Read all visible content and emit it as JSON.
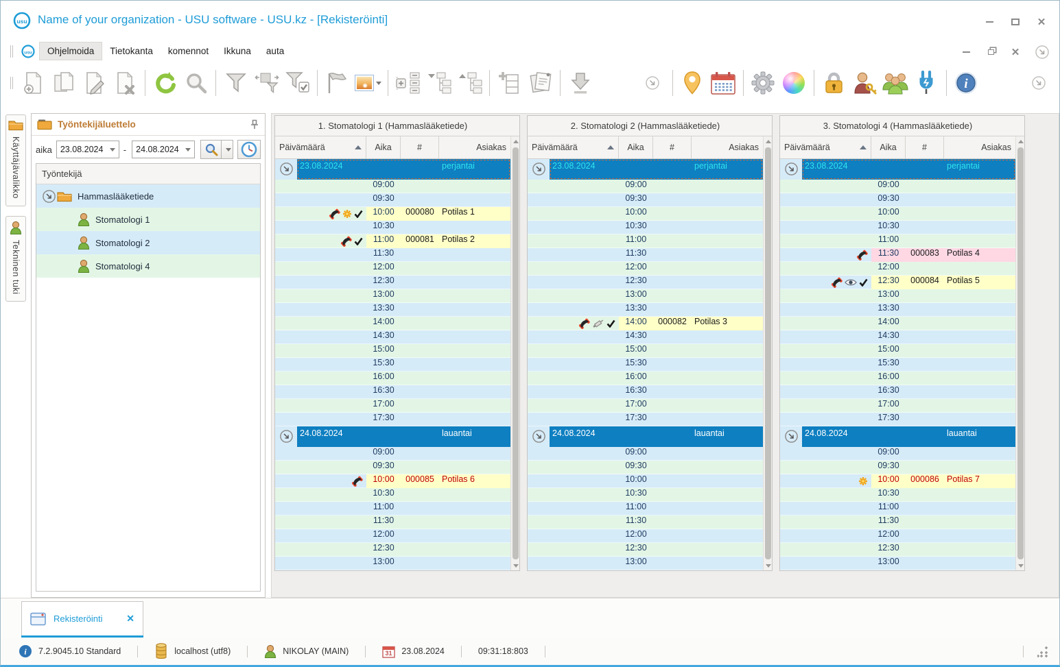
{
  "window": {
    "title": "Name of your organization - USU software - USU.kz - [Rekisteröinti]",
    "controls": [
      "minimize",
      "maximize",
      "close"
    ],
    "mdi_controls": [
      "minimize",
      "restore",
      "close",
      "chevron-circle"
    ]
  },
  "menu": {
    "items": [
      {
        "label": "Ohjelmoida",
        "highlighted": true
      },
      {
        "label": "Tietokanta",
        "highlighted": false
      },
      {
        "label": "komennot",
        "highlighted": false
      },
      {
        "label": "Ikkuna",
        "highlighted": false
      },
      {
        "label": "auta",
        "highlighted": false
      }
    ]
  },
  "toolbar": {
    "items": [
      {
        "type": "grip"
      },
      {
        "type": "icon",
        "name": "doc-new"
      },
      {
        "type": "icon",
        "name": "doc-copy"
      },
      {
        "type": "icon",
        "name": "doc-edit"
      },
      {
        "type": "icon",
        "name": "doc-delete"
      },
      {
        "type": "sep"
      },
      {
        "type": "icon",
        "name": "refresh"
      },
      {
        "type": "icon",
        "name": "search"
      },
      {
        "type": "sep"
      },
      {
        "type": "icon",
        "name": "filter"
      },
      {
        "type": "icon",
        "name": "filter-columns"
      },
      {
        "type": "icon",
        "name": "filter-check"
      },
      {
        "type": "sep"
      },
      {
        "type": "icon",
        "name": "flag"
      },
      {
        "type": "icon",
        "name": "image",
        "dropdown": true
      },
      {
        "type": "sep"
      },
      {
        "type": "icon",
        "name": "tree-toggle"
      },
      {
        "type": "icon",
        "name": "tree-down"
      },
      {
        "type": "icon",
        "name": "tree-up"
      },
      {
        "type": "sep"
      },
      {
        "type": "icon",
        "name": "add-row"
      },
      {
        "type": "icon",
        "name": "documents"
      },
      {
        "type": "sep"
      },
      {
        "type": "icon",
        "name": "download"
      },
      {
        "type": "spacer"
      },
      {
        "type": "icon",
        "name": "chevron-circle"
      },
      {
        "type": "sep"
      },
      {
        "type": "icon",
        "name": "map-pin"
      },
      {
        "type": "icon",
        "name": "calendar"
      },
      {
        "type": "sep"
      },
      {
        "type": "icon",
        "name": "gear"
      },
      {
        "type": "icon",
        "name": "color-wheel"
      },
      {
        "type": "sep"
      },
      {
        "type": "icon",
        "name": "lock"
      },
      {
        "type": "icon",
        "name": "user-key"
      },
      {
        "type": "icon",
        "name": "user-group"
      },
      {
        "type": "icon",
        "name": "plug"
      },
      {
        "type": "sep"
      },
      {
        "type": "icon",
        "name": "info"
      },
      {
        "type": "spacer"
      },
      {
        "type": "icon",
        "name": "chevron-circle"
      }
    ]
  },
  "sidebar": {
    "tabs": [
      {
        "label": "Käyttäjävalikko",
        "icon": "folder-open"
      },
      {
        "label": "Tekninen tuki",
        "icon": "person"
      }
    ]
  },
  "employee_panel": {
    "title": "Työntekijäluettelo",
    "pin_icon": "pushpin",
    "filter": {
      "label": "aika",
      "from_value": "23.08.2024",
      "separator": "-",
      "to_value": "24.08.2024",
      "buttons": [
        "search",
        "search-dropdown",
        "clock"
      ]
    },
    "tree_header": "Työntekijä",
    "tree": [
      {
        "label": "Hammaslääketiede",
        "icon": "folder-open",
        "level": 0,
        "row": "blue",
        "expander": true
      },
      {
        "label": "Stomatologi 1",
        "icon": "person",
        "level": 1,
        "row": "green",
        "expander": false
      },
      {
        "label": "Stomatologi 2",
        "icon": "person",
        "level": 1,
        "row": "blue",
        "expander": false
      },
      {
        "label": "Stomatologi 4",
        "icon": "person",
        "level": 1,
        "row": "green",
        "expander": false
      }
    ]
  },
  "schedules": [
    {
      "title": "1. Stomatologi 1 (Hammaslääketiede)",
      "columns": {
        "date": "Päivämäärä",
        "time": "Aika",
        "number": "#",
        "client": "Asiakas"
      },
      "days": [
        {
          "date": "23.08.2024",
          "weekday": "perjantai",
          "focused": true,
          "start": "green",
          "slots": [
            {
              "time": "09:00"
            },
            {
              "time": "09:30"
            },
            {
              "time": "10:00",
              "number": "000080",
              "client": "Potilas 1",
              "icons": [
                "phone",
                "spark",
                "check"
              ],
              "highlight": "yellow",
              "text": "black"
            },
            {
              "time": "10:30"
            },
            {
              "time": "11:00",
              "number": "000081",
              "client": "Potilas 2",
              "icons": [
                "phone",
                "check"
              ],
              "highlight": "yellow",
              "text": "black"
            },
            {
              "time": "11:30"
            },
            {
              "time": "12:00"
            },
            {
              "time": "12:30"
            },
            {
              "time": "13:00"
            },
            {
              "time": "13:30"
            },
            {
              "time": "14:00"
            },
            {
              "time": "14:30"
            },
            {
              "time": "15:00"
            },
            {
              "time": "15:30"
            },
            {
              "time": "16:00"
            },
            {
              "time": "16:30"
            },
            {
              "time": "17:00"
            },
            {
              "time": "17:30"
            }
          ]
        },
        {
          "date": "24.08.2024",
          "weekday": "lauantai",
          "focused": false,
          "start": "blue",
          "slots": [
            {
              "time": "09:00"
            },
            {
              "time": "09:30"
            },
            {
              "time": "10:00",
              "number": "000085",
              "client": "Potilas 6",
              "icons": [
                "phone"
              ],
              "highlight": "yellow",
              "text": "red"
            },
            {
              "time": "10:30"
            },
            {
              "time": "11:00"
            },
            {
              "time": "11:30"
            },
            {
              "time": "12:00"
            },
            {
              "time": "12:30"
            },
            {
              "time": "13:00"
            }
          ]
        }
      ]
    },
    {
      "title": "2. Stomatologi 2 (Hammaslääketiede)",
      "columns": {
        "date": "Päivämäärä",
        "time": "Aika",
        "number": "#",
        "client": "Asiakas"
      },
      "days": [
        {
          "date": "23.08.2024",
          "weekday": "perjantai",
          "focused": true,
          "start": "green",
          "slots": [
            {
              "time": "09:00"
            },
            {
              "time": "09:30"
            },
            {
              "time": "10:00"
            },
            {
              "time": "10:30"
            },
            {
              "time": "11:00"
            },
            {
              "time": "11:30"
            },
            {
              "time": "12:00"
            },
            {
              "time": "12:30"
            },
            {
              "time": "13:00"
            },
            {
              "time": "13:30"
            },
            {
              "time": "14:00",
              "number": "000082",
              "client": "Potilas 3",
              "icons": [
                "phone",
                "syringe",
                "check"
              ],
              "highlight": "yellow",
              "text": "black"
            },
            {
              "time": "14:30"
            },
            {
              "time": "15:00"
            },
            {
              "time": "15:30"
            },
            {
              "time": "16:00"
            },
            {
              "time": "16:30"
            },
            {
              "time": "17:00"
            },
            {
              "time": "17:30"
            }
          ]
        },
        {
          "date": "24.08.2024",
          "weekday": "lauantai",
          "focused": false,
          "start": "blue",
          "slots": [
            {
              "time": "09:00"
            },
            {
              "time": "09:30"
            },
            {
              "time": "10:00"
            },
            {
              "time": "10:30"
            },
            {
              "time": "11:00"
            },
            {
              "time": "11:30"
            },
            {
              "time": "12:00"
            },
            {
              "time": "12:30"
            },
            {
              "time": "13:00"
            }
          ]
        }
      ]
    },
    {
      "title": "3. Stomatologi 4 (Hammaslääketiede)",
      "columns": {
        "date": "Päivämäärä",
        "time": "Aika",
        "number": "#",
        "client": "Asiakas"
      },
      "days": [
        {
          "date": "23.08.2024",
          "weekday": "perjantai",
          "focused": true,
          "start": "green",
          "slots": [
            {
              "time": "09:00"
            },
            {
              "time": "09:30"
            },
            {
              "time": "10:00"
            },
            {
              "time": "10:30"
            },
            {
              "time": "11:00"
            },
            {
              "time": "11:30",
              "number": "000083",
              "client": "Potilas 4",
              "icons": [
                "phone"
              ],
              "highlight": "pink",
              "text": "black"
            },
            {
              "time": "12:00"
            },
            {
              "time": "12:30",
              "number": "000084",
              "client": "Potilas 5",
              "icons": [
                "phone",
                "eye",
                "check"
              ],
              "highlight": "yellow",
              "text": "black"
            },
            {
              "time": "13:00"
            },
            {
              "time": "13:30"
            },
            {
              "time": "14:00"
            },
            {
              "time": "14:30"
            },
            {
              "time": "15:00"
            },
            {
              "time": "15:30"
            },
            {
              "time": "16:00"
            },
            {
              "time": "16:30"
            },
            {
              "time": "17:00"
            },
            {
              "time": "17:30"
            }
          ]
        },
        {
          "date": "24.08.2024",
          "weekday": "lauantai",
          "focused": false,
          "start": "blue",
          "slots": [
            {
              "time": "09:00"
            },
            {
              "time": "09:30"
            },
            {
              "time": "10:00",
              "number": "000086",
              "client": "Potilas 7",
              "icons": [
                "spark"
              ],
              "highlight": "yellow",
              "text": "red"
            },
            {
              "time": "10:30"
            },
            {
              "time": "11:00"
            },
            {
              "time": "11:30"
            },
            {
              "time": "12:00"
            },
            {
              "time": "12:30"
            },
            {
              "time": "13:00"
            }
          ]
        }
      ]
    }
  ],
  "tab_bar": {
    "tabs": [
      {
        "label": "Rekisteröinti",
        "icon": "window-glyph",
        "close": "✕",
        "active": true
      }
    ]
  },
  "status_bar": {
    "items": [
      {
        "icon": "info-badge",
        "text": "7.2.9045.10 Standard"
      },
      {
        "sep": true
      },
      {
        "icon": "database",
        "text": "localhost (utf8)"
      },
      {
        "sep": true
      },
      {
        "icon": "person",
        "text": "NIKOLAY (MAIN)"
      },
      {
        "sep": true
      },
      {
        "icon": "calendar-day",
        "icon_label": "31",
        "text": "23.08.2024"
      },
      {
        "sep": true
      },
      {
        "text": "09:31:18:803"
      },
      {
        "sep": true
      }
    ]
  },
  "colors": {
    "accent_blue": "#1e9cd7",
    "day_bar_blue": "#0e7fc1",
    "day_focus_text": "#2fe3ee",
    "row_blue": "#d6ebf8",
    "row_green": "#e3f6e6",
    "appointment_yellow": "#ffffc8",
    "appointment_pink": "#ffd8e4",
    "appointment_red_text": "#c00000",
    "time_text": "#1d3a5f",
    "panel_header_bg": "#f5f4f2",
    "border": "#c6c4c2",
    "employee_title": "#bd7b35"
  }
}
